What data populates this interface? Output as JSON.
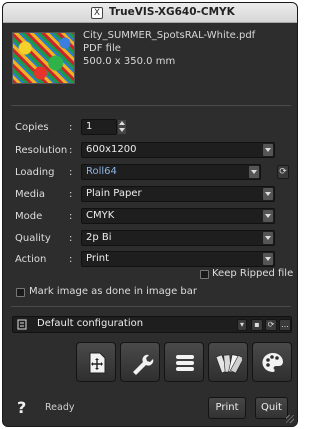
{
  "window": {
    "title": "TrueVIS-XG640-CMYK"
  },
  "file": {
    "name": "City_SUMMER_SpotsRAL-White.pdf",
    "type": "PDF file",
    "size": "500.0 x 350.0 mm"
  },
  "form": {
    "copies": {
      "label": "Copies",
      "value": "1"
    },
    "resolution": {
      "label": "Resolution",
      "value": "600x1200"
    },
    "loading": {
      "label": "Loading",
      "value": "Roll64"
    },
    "media": {
      "label": "Media",
      "value": "Plain Paper"
    },
    "mode": {
      "label": "Mode",
      "value": "CMYK"
    },
    "quality": {
      "label": "Quality",
      "value": "2p Bi"
    },
    "action": {
      "label": "Action",
      "value": "Print"
    },
    "colon": ":"
  },
  "options": {
    "keep_ripped": {
      "label": "Keep Ripped file",
      "checked": false
    },
    "mark_done": {
      "label": "Mark image as done in image bar",
      "checked": false
    }
  },
  "config": {
    "label": "Default configuration",
    "more": "..."
  },
  "tools": [
    "layout-icon",
    "wrench-icon",
    "list-icon",
    "swatch-icon",
    "palette-icon"
  ],
  "footer": {
    "help": "?",
    "status": "Ready",
    "print_label": "Print",
    "quit_label": "Quit"
  },
  "colors": {
    "background": "#2d2d2d",
    "field": "#1e1e1e",
    "link": "#8cb4e6"
  }
}
